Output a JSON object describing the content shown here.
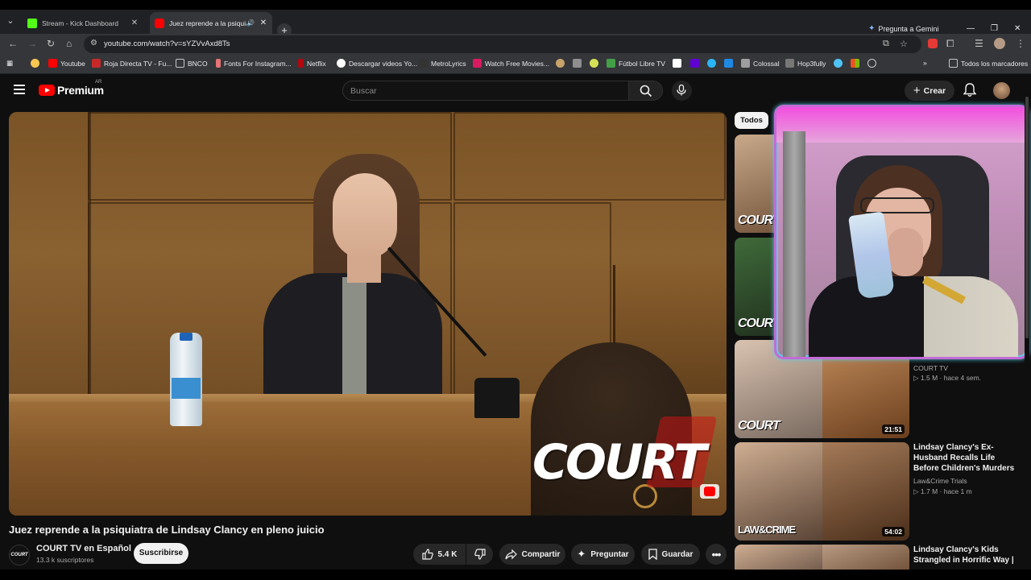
{
  "browser": {
    "tabs": [
      {
        "title": "Stream - Kick Dashboard",
        "favicon_color": "#53fc18"
      },
      {
        "title": "Juez reprende a la psiquiat",
        "favicon_color": "#ff0000"
      }
    ],
    "gemini": "Pregunta a Gemini",
    "url": "youtube.com/watch?v=sYZVvAxd8Ts",
    "bookmarks": [
      "Youtube",
      "Roja Directa TV - Fu...",
      "BNCO",
      "Fonts For Instagram...",
      "Netflix",
      "Descargar videos Yo...",
      "MetroLyrics",
      "Watch Free Movies...",
      "Fútbol Libre TV",
      "Colossal",
      "Hop3fully"
    ],
    "all_bookmarks": "Todos los marcadores"
  },
  "youtube": {
    "logo_text": "Premium",
    "region": "AR",
    "search_placeholder": "Buscar",
    "create_label": "Crear",
    "chip_all": "Todos"
  },
  "video": {
    "title": "Juez reprende a la psiquiatra de Lindsay Clancy en pleno juicio",
    "watermark": "COURT",
    "channel_name": "COURT TV en Español",
    "channel_avatar_text": "COURT",
    "subscribers": "13.3 k suscriptores",
    "subscribe_label": "Suscribirse",
    "likes": "5.4 K",
    "share_label": "Compartir",
    "ask_label": "Preguntar",
    "save_label": "Guardar"
  },
  "related": [
    {
      "brand": "COURT",
      "channel": "COURT TV",
      "meta": "▷ 1.5 M · hace 4 sem.",
      "duration": "21:51"
    },
    {
      "brand": "LAW&CRIME",
      "title": "Lindsay Clancy's Ex-Husband Recalls Life Before Children's Murders",
      "channel": "Law&Crime Trials",
      "meta": "▷ 1.7 M · hace 1 m",
      "duration": "54:02"
    },
    {
      "title": "Lindsay Clancy's Kids Strangled in Horrific Way |"
    }
  ],
  "related_brand_top": "COURT"
}
